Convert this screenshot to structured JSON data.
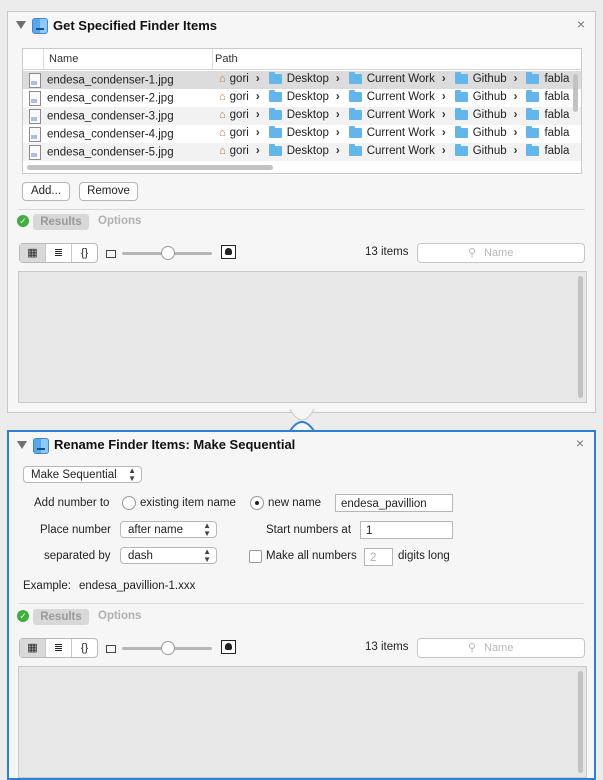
{
  "action1": {
    "title": "Get Specified Finder Items",
    "columns": [
      "Name",
      "Path"
    ],
    "rows": [
      {
        "name": "endesa_condenser-1.jpg",
        "path": [
          "gori",
          "Desktop",
          "Current Work",
          "Github",
          "fabla"
        ]
      },
      {
        "name": "endesa_condenser-2.jpg",
        "path": [
          "gori",
          "Desktop",
          "Current Work",
          "Github",
          "fabla"
        ]
      },
      {
        "name": "endesa_condenser-3.jpg",
        "path": [
          "gori",
          "Desktop",
          "Current Work",
          "Github",
          "fabla"
        ]
      },
      {
        "name": "endesa_condenser-4.jpg",
        "path": [
          "gori",
          "Desktop",
          "Current Work",
          "Github",
          "fabla"
        ]
      },
      {
        "name": "endesa_condenser-5.jpg",
        "path": [
          "gori",
          "Desktop",
          "Current Work",
          "Github",
          "fabla"
        ]
      }
    ],
    "add_label": "Add...",
    "remove_label": "Remove",
    "results_tab": "Results",
    "options_tab": "Options",
    "view_modes": [
      "grid",
      "list",
      "{}"
    ],
    "item_count": "13 items",
    "search_placeholder": "Name"
  },
  "action2": {
    "title": "Rename Finder Items: Make Sequential",
    "mode": "Make Sequential",
    "add_number_to_label": "Add number to",
    "existing_item_name_label": "existing item name",
    "new_name_label": "new name",
    "new_name_value": "endesa_pavillion",
    "place_number_label": "Place number",
    "place_number_value": "after name",
    "start_numbers_label": "Start numbers at",
    "start_numbers_value": "1",
    "separated_by_label": "separated by",
    "separated_by_value": "dash",
    "make_all_numbers_label": "Make all numbers",
    "digits_value": "2",
    "digits_long_label": "digits long",
    "example_label": "Example:",
    "example_value": "endesa_pavillion-1.xxx",
    "results_tab": "Results",
    "options_tab": "Options",
    "item_count": "13 items",
    "search_placeholder": "Name"
  }
}
